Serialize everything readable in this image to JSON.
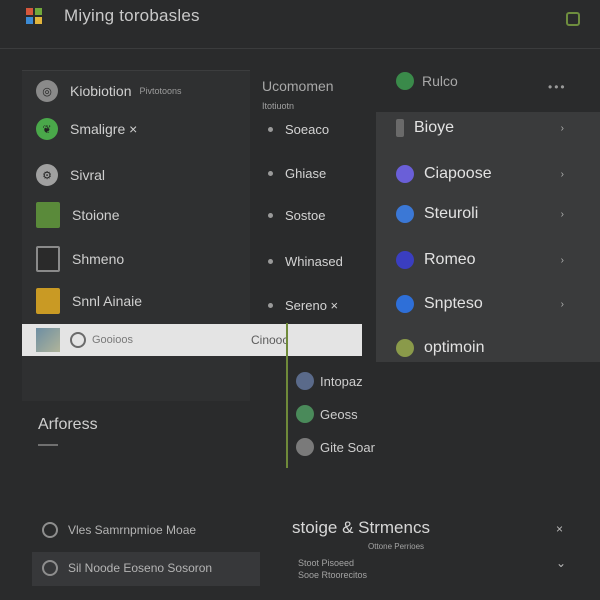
{
  "app": {
    "title": "Miying torobasles"
  },
  "left_menu": {
    "items": [
      {
        "label": "Kiobiotion",
        "sub": "Pivtotoons",
        "icon": "globe-icon",
        "color": "#8a8a8a"
      },
      {
        "label": "Smaligre ×",
        "sub": "",
        "icon": "leaf-icon",
        "color": "#4aa84a"
      },
      {
        "label": "Sivral",
        "sub": "",
        "icon": "settings-icon",
        "color": "#a0a0a0"
      },
      {
        "label": "Stoione",
        "sub": "",
        "icon": "picture-icon",
        "color": "#5a8a3a"
      },
      {
        "label": "Shmeno",
        "sub": "",
        "icon": "document-icon",
        "color": "#8a8a8a"
      },
      {
        "label": "Snnl Ainaie",
        "sub": "",
        "icon": "folder-icon",
        "color": "#c99a24"
      }
    ],
    "selected": {
      "label": "Gooioos",
      "label2": "Cinooc"
    }
  },
  "section_heading": "Arforess",
  "mid_column": {
    "title": "Ucomomen",
    "sub": "Itotiuotn",
    "items": [
      "Soeaco",
      "Ghiase",
      "Sostoe",
      "Whinased",
      "Sereno ×"
    ]
  },
  "right_panel": {
    "title": "Rulco",
    "ellipsis": "•••",
    "items": [
      {
        "label": "Bioye",
        "icon": "bar-icon",
        "color": "#6a6a6a"
      },
      {
        "label": "Ciapoose",
        "icon": "lock-icon",
        "color": "#6a5fd8"
      },
      {
        "label": "Steuroli",
        "icon": "info-icon",
        "color": "#3b78d6"
      },
      {
        "label": "Romeo",
        "icon": "person-icon",
        "color": "#3a3ec0"
      },
      {
        "label": "Snpteso",
        "icon": "question-icon",
        "color": "#2e6fd8"
      },
      {
        "label": "optimoin",
        "icon": "chat-icon",
        "color": "#8a9a4a"
      }
    ]
  },
  "dropdown": {
    "items": [
      {
        "label": "Intopaz",
        "color": "#5a6a8a"
      },
      {
        "label": "Geoss",
        "color": "#4a8a5a"
      },
      {
        "label": "Gite Soar",
        "color": "#7a7a7a"
      }
    ]
  },
  "bottom": {
    "left_row1": "Vles Samrnpmioe Moae",
    "left_row2": "Sil Noode Eoseno Sosoron",
    "storage_title": "stoige & Strmencs",
    "storage_sub": "Ottone Perrioes",
    "storage_line1": "Stoot Pisoeed",
    "storage_line2": "Sooe Rtoorecitos",
    "close_label": "×",
    "chevron_label": "⌄"
  }
}
